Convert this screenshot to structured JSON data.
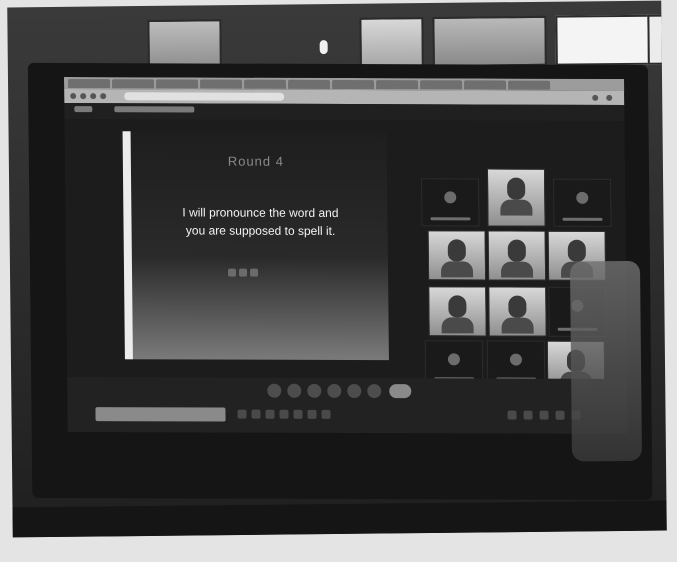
{
  "slide": {
    "title": "Round 4",
    "line1": "I will pronounce the word and",
    "line2": "you are supposed to spell it."
  },
  "colors": {
    "room": "#2a2a2a",
    "screen": "#1c1c1c",
    "slide_text": "#f4f4f4"
  },
  "icons": [
    "camera-icon",
    "mic-icon",
    "hangup-icon",
    "chat-icon",
    "participants-icon",
    "share-icon"
  ]
}
